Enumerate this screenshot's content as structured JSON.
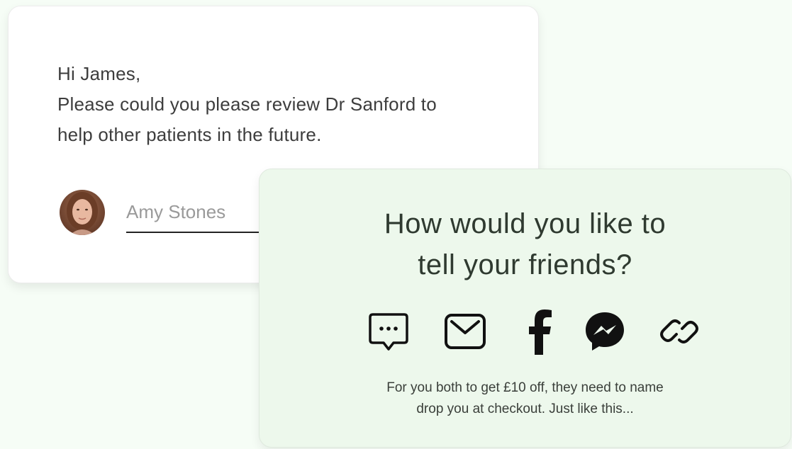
{
  "message": {
    "greeting": "Hi James,",
    "line_1": "Please could you please review Dr Sanford to",
    "line_2": "help other patients in the future.",
    "signature_placeholder": "Amy Stones"
  },
  "share": {
    "title_line_1": "How would you like to",
    "title_line_2": "tell your friends?",
    "icons": [
      "sms-chat-icon",
      "email-icon",
      "facebook-icon",
      "messenger-icon",
      "link-icon"
    ],
    "note_line_1": "For you both to get £10 off, they need to name",
    "note_line_2": "drop you at checkout. Just like this..."
  },
  "colors": {
    "background": "#f6fdf6",
    "share_card": "#edf8ec",
    "text_dark": "#2f3a30"
  }
}
